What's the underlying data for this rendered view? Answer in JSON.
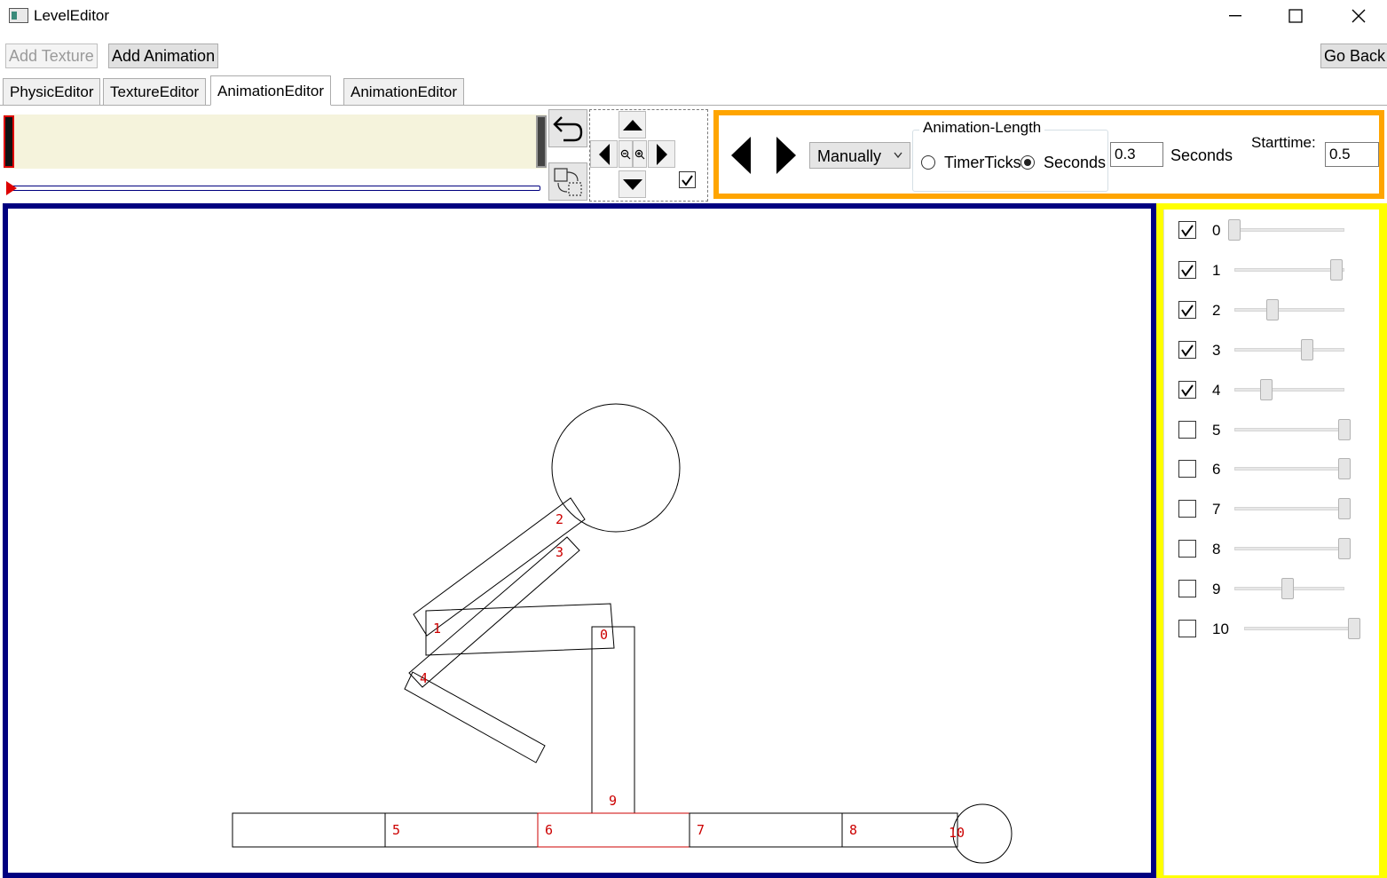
{
  "window": {
    "title": "LevelEditor",
    "icons": [
      "app-icon",
      "minimize-icon",
      "maximize-icon",
      "close-icon"
    ]
  },
  "toolbar": {
    "add_texture": "Add Texture",
    "add_animation": "Add Animation",
    "go_back": "Go Back"
  },
  "tabs": [
    {
      "label": "PhysicEditor",
      "active": false
    },
    {
      "label": "TextureEditor",
      "active": false
    },
    {
      "label": "AnimationEditor",
      "active": true
    },
    {
      "label": "AnimationEditor",
      "active": false
    }
  ],
  "animation": {
    "mode": "Manually",
    "length_group": "Animation-Length",
    "option_ticks": "TimerTicks",
    "option_seconds": "Seconds",
    "selected_option": "Seconds",
    "length_value": "0.3",
    "length_unit": "Seconds",
    "starttime_label": "Starttime:",
    "starttime_value": "0.5"
  },
  "tools": {
    "icons": [
      "undo-icon",
      "crop-transform-icon",
      "arrow-up-icon",
      "arrow-left-icon",
      "zoom-out-icon",
      "zoom-in-icon",
      "arrow-right-icon",
      "arrow-down-icon",
      "check-icon",
      "prev-frame-icon",
      "next-frame-icon"
    ],
    "pad_checkbox_checked": true
  },
  "canvas_labels": [
    "0",
    "1",
    "2",
    "3",
    "4",
    "5",
    "6",
    "7",
    "8",
    "9",
    "10"
  ],
  "joints": [
    {
      "label": "0",
      "checked": true,
      "level": 0.0
    },
    {
      "label": "1",
      "checked": true,
      "level": 0.93
    },
    {
      "label": "2",
      "checked": true,
      "level": 0.35
    },
    {
      "label": "3",
      "checked": true,
      "level": 0.66
    },
    {
      "label": "4",
      "checked": true,
      "level": 0.29
    },
    {
      "label": "5",
      "checked": false,
      "level": 1.0
    },
    {
      "label": "6",
      "checked": false,
      "level": 1.0
    },
    {
      "label": "7",
      "checked": false,
      "level": 1.0
    },
    {
      "label": "8",
      "checked": false,
      "level": 1.0
    },
    {
      "label": "9",
      "checked": false,
      "level": 0.48
    },
    {
      "label": "10",
      "checked": false,
      "level": 1.0
    }
  ],
  "colors": {
    "canvas_border": "#000080",
    "header_border": "#ffa500",
    "side_border": "#ffff00",
    "joint_label": "#cc0000",
    "timeline_bg": "#f5f3dc"
  }
}
